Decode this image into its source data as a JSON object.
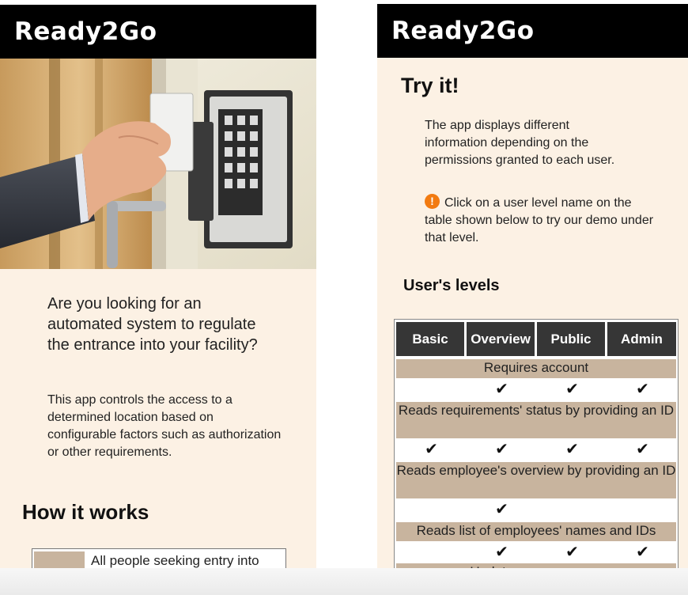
{
  "left": {
    "brand": "Ready2Go",
    "question": "Are you looking for an automated system to regulate the entrance into your facility?",
    "description": "This app controls the access to a determined location based on configurable factors such as authorization or other requirements.",
    "how_title": "How it works",
    "step1": "All people seeking entry into"
  },
  "right": {
    "brand": "Ready2Go",
    "try_title": "Try it!",
    "intro": "The app displays different information depending on the permissions granted to each user.",
    "warn_icon": "!",
    "instruction": "Click on a user level name on the table shown below to try our demo under that level.",
    "levels_title": "User's levels",
    "table": {
      "columns": [
        "Basic",
        "Overview",
        "Public",
        "Admin"
      ],
      "rows": [
        {
          "feature": "Requires account",
          "checks": [
            false,
            true,
            true,
            true
          ]
        },
        {
          "feature": "Reads requirements' status by providing an ID",
          "checks": [
            true,
            true,
            true,
            true
          ]
        },
        {
          "feature": "Reads employee's overview by providing an ID",
          "checks": [
            false,
            true,
            false,
            false
          ]
        },
        {
          "feature": "Reads list of employees' names and IDs",
          "checks": [
            false,
            true,
            true,
            true
          ]
        }
      ],
      "partial_row": "Updates .......... ..........",
      "check_glyph": "✔"
    }
  },
  "colors": {
    "header": "#000000",
    "page_bg": "#fcf1e4",
    "table_header": "#363636",
    "feature_row": "#c8b49e",
    "warning": "#f27a10"
  }
}
